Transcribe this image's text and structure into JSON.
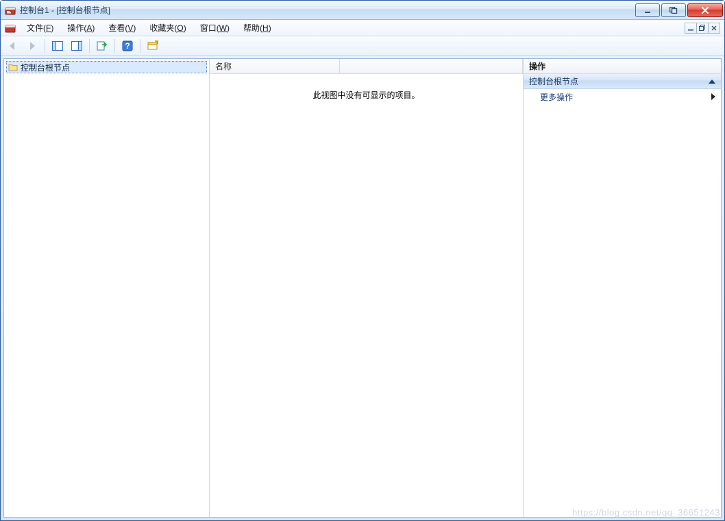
{
  "window": {
    "title": "控制台1 - [控制台根节点]"
  },
  "menu": {
    "file": {
      "pre": "文件(",
      "acc": "F",
      "post": ")"
    },
    "action": {
      "pre": "操作(",
      "acc": "A",
      "post": ")"
    },
    "view": {
      "pre": "查看(",
      "acc": "V",
      "post": ")"
    },
    "favorites": {
      "pre": "收藏夹(",
      "acc": "O",
      "post": ")"
    },
    "window": {
      "pre": "窗口(",
      "acc": "W",
      "post": ")"
    },
    "help": {
      "pre": "帮助(",
      "acc": "H",
      "post": ")"
    }
  },
  "tree": {
    "root_label": "控制台根节点"
  },
  "list": {
    "col_name_header": "名称",
    "empty_text": "此视图中没有可显示的项目。"
  },
  "actions": {
    "header": "操作",
    "group_title": "控制台根节点",
    "more_actions": "更多操作"
  },
  "watermark": "https://blog.csdn.net/qq_36651243"
}
